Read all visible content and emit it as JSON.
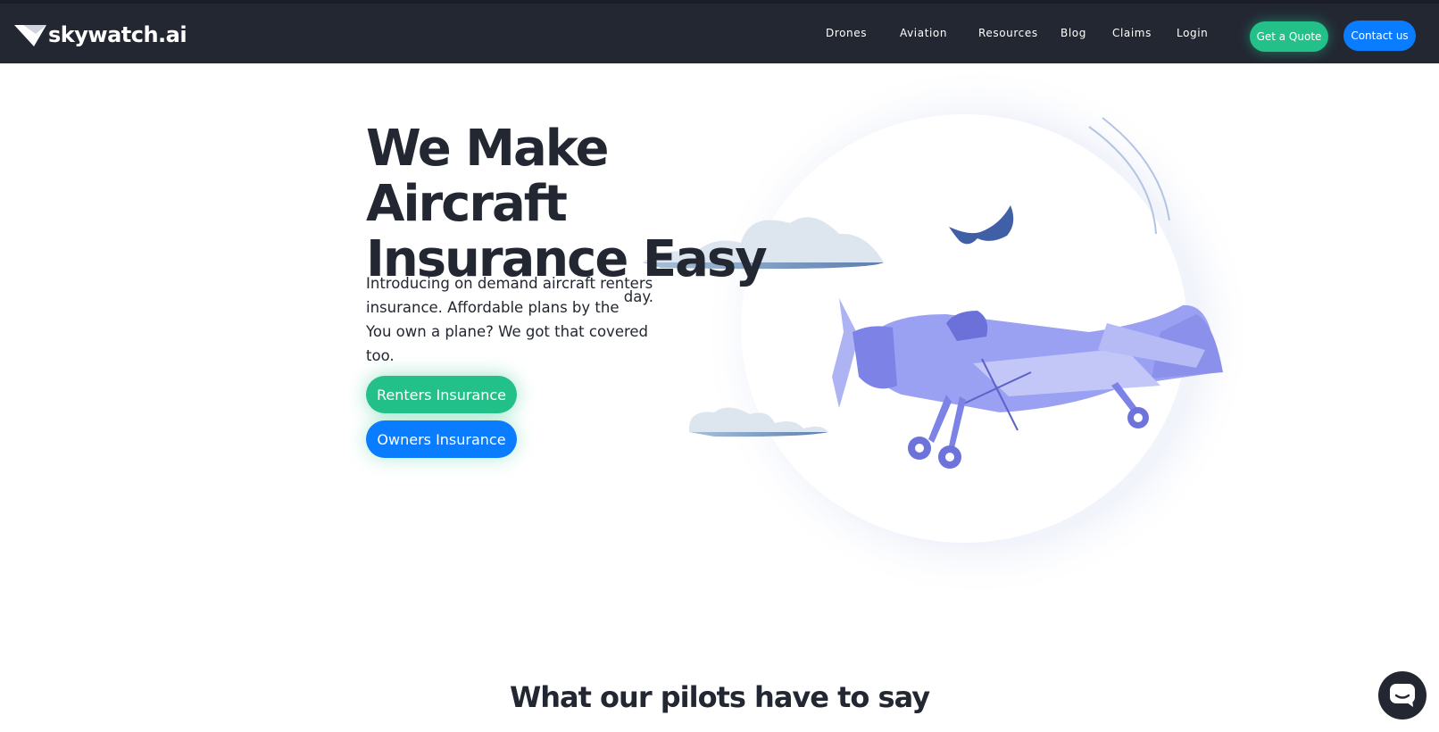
{
  "brand": {
    "name": "skywatch.ai"
  },
  "nav": {
    "items": [
      "Drones",
      "Aviation",
      "Resources",
      "Blog",
      "Claims",
      "Login"
    ],
    "quote_label": "Get a Quote",
    "contact_label": "Contact us"
  },
  "hero": {
    "title_line1": "We Make Aircraft",
    "title_line2": "Insurance Easy",
    "subtitle_line1": "Introducing on demand aircraft renters",
    "subtitle_line2": "insurance. Affordable plans by the",
    "subtitle_day": "day.",
    "subtitle_line3": "You own a plane? We got that covered too.",
    "renters_label": "Renters Insurance",
    "owners_label": "Owners Insurance"
  },
  "testimonials": {
    "heading": "What our pilots have to say"
  },
  "chat": {
    "icon": "chat-icon"
  },
  "colors": {
    "nav_bg": "#232732",
    "green": "#23c08a",
    "blue": "#0a7cff",
    "plane": "#9aa0f2",
    "plane_dark": "#7c82e6",
    "cloud": "#d8e2ee"
  }
}
